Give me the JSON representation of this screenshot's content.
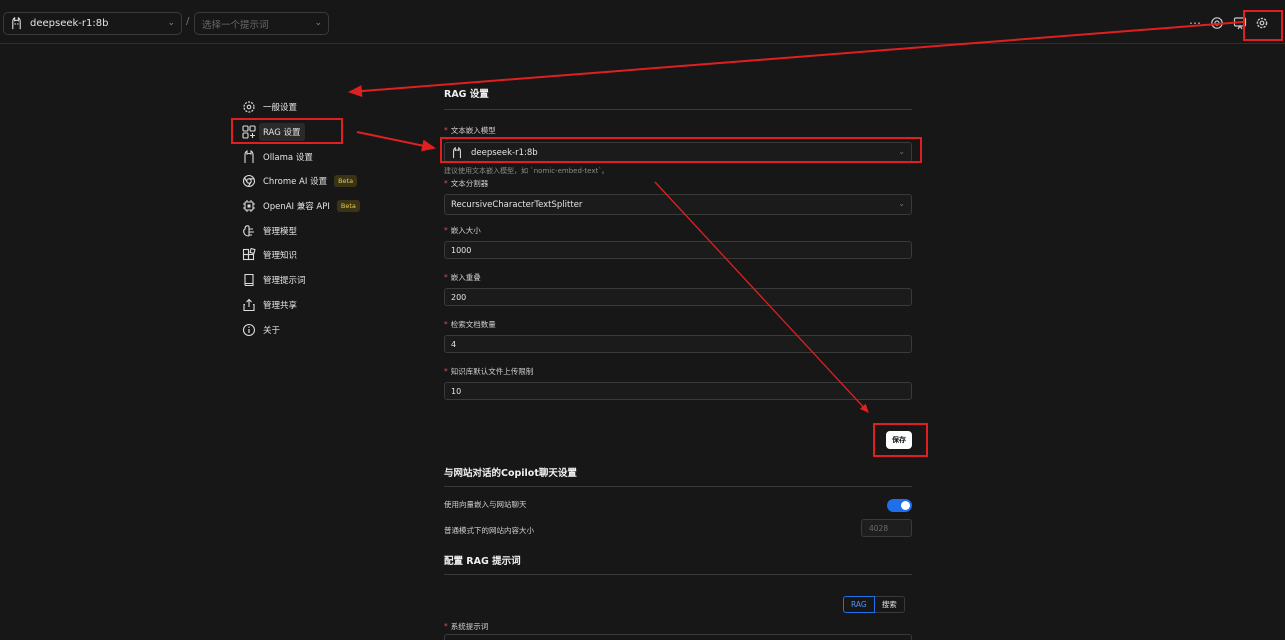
{
  "topbar": {
    "model": "deepseek-r1:8b",
    "separator": "/",
    "prompt_placeholder": "选择一个提示词",
    "icons": [
      "more-icon",
      "settings-icon",
      "share-icon",
      "gear-icon"
    ]
  },
  "sidebar": {
    "items": [
      {
        "label": "一般设置",
        "icon": "gear-icon"
      },
      {
        "label": "RAG 设置",
        "icon": "rag-icon",
        "active": true
      },
      {
        "label": "Ollama 设置",
        "icon": "ollama-icon"
      },
      {
        "label": "Chrome AI 设置",
        "icon": "chrome-icon",
        "badge": "Beta"
      },
      {
        "label": "OpenAI 兼容 API",
        "icon": "chip-icon",
        "badge": "Beta"
      },
      {
        "label": "管理模型",
        "icon": "brain-icon"
      },
      {
        "label": "管理知识",
        "icon": "blocks-icon"
      },
      {
        "label": "管理提示词",
        "icon": "book-icon"
      },
      {
        "label": "管理共享",
        "icon": "upload-icon"
      },
      {
        "label": "关于",
        "icon": "info-icon"
      }
    ]
  },
  "rag": {
    "title": "RAG 设置",
    "embedding_label": "文本嵌入模型",
    "embedding_value": "deepseek-r1:8b",
    "embedding_help": "建议使用文本嵌入模型，如 `nomic-embed-text`。",
    "splitter_label": "文本分割器",
    "splitter_value": "RecursiveCharacterTextSplitter",
    "chunk_size_label": "嵌入大小",
    "chunk_size_value": "1000",
    "chunk_overlap_label": "嵌入重叠",
    "chunk_overlap_value": "200",
    "retrieve_label": "检索文档数量",
    "retrieve_value": "4",
    "upload_limit_label": "知识库默认文件上传限制",
    "upload_limit_value": "10",
    "save_label": "保存"
  },
  "copilot": {
    "title": "与网站对话的Copilot聊天设置",
    "vector_label": "使用向量嵌入与网站聊天",
    "vector_enabled": true,
    "content_size_label": "普通模式下的网站内容大小",
    "content_size_value": "4028"
  },
  "rag_prompt": {
    "title": "配置 RAG 提示词",
    "tab_rag": "RAG",
    "tab_search": "搜索",
    "system_prompt_label": "系统提示词"
  },
  "colors": {
    "background": "#171717",
    "accent": "#1f6feb",
    "annotation": "#e02020",
    "beta": "#e7c84f"
  }
}
